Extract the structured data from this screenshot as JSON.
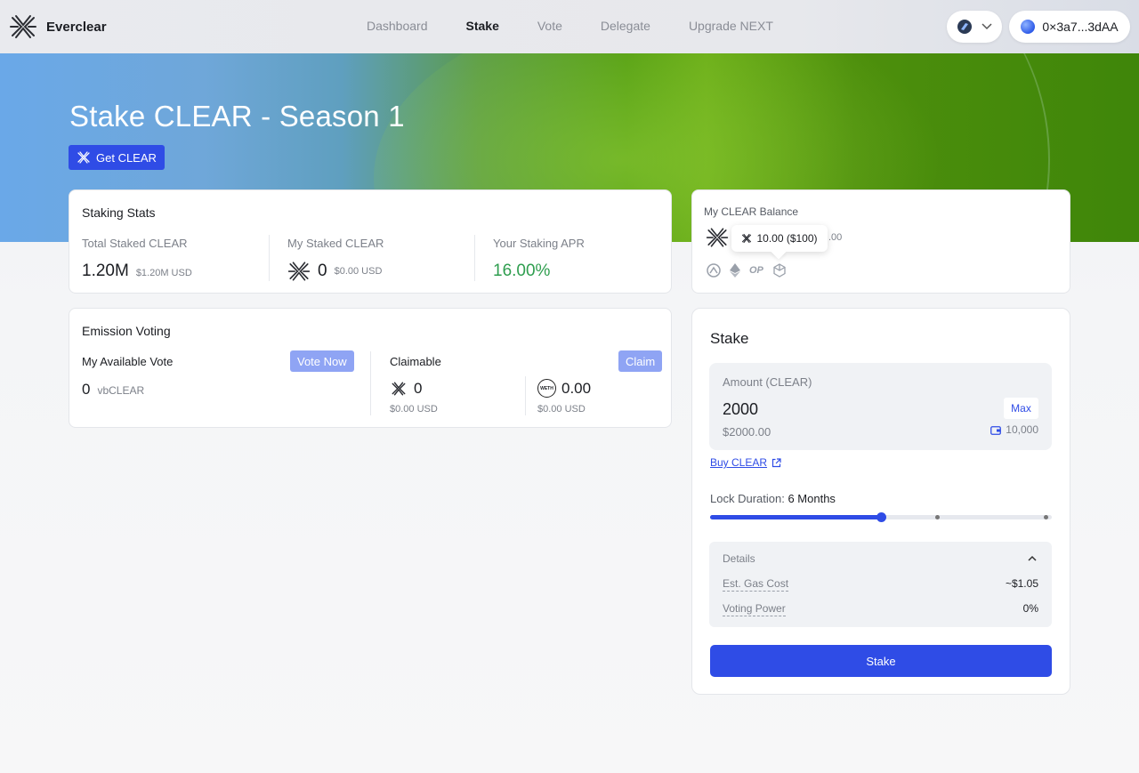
{
  "header": {
    "brand": "Everclear",
    "nav": [
      "Dashboard",
      "Stake",
      "Vote",
      "Delegate",
      "Upgrade NEXT"
    ],
    "active_nav": "Stake",
    "wallet": "0×3a7...3dAA"
  },
  "hero": {
    "title": "Stake CLEAR - Season 1",
    "get_button": "Get CLEAR"
  },
  "staking_stats": {
    "title": "Staking Stats",
    "total_label": "Total Staked CLEAR",
    "total_value": "1.20M",
    "total_usd": "$1.20M USD",
    "mine_label": "My Staked CLEAR",
    "mine_value": "0",
    "mine_usd": "$0.00 USD",
    "apr_label": "Your Staking APR",
    "apr_value": "16.00%"
  },
  "emission_voting": {
    "title": "Emission Voting",
    "available_label": "My Available Vote",
    "vote_button": "Vote Now",
    "available_value": "0",
    "available_unit": "vbCLEAR",
    "claimable_label": "Claimable",
    "claim_button": "Claim",
    "clear_value": "0",
    "clear_usd": "$0.00 USD",
    "weth_value": "0.00",
    "weth_usd": "$0.00 USD",
    "weth_badge": "WETH"
  },
  "balance": {
    "title": "My CLEAR Balance",
    "value_suffix": ".00",
    "tooltip": "10.00 ($100)",
    "chain_op": "OP"
  },
  "stake": {
    "title": "Stake",
    "amount_label": "Amount (CLEAR)",
    "amount_value": "2000",
    "amount_usd": "$2000.00",
    "max_button": "Max",
    "wallet_balance": "10,000",
    "buy_link": "Buy CLEAR",
    "lock_label": "Lock Duration:",
    "lock_value": "6 Months",
    "lock_fraction": 0.5,
    "details_label": "Details",
    "gas_label": "Est. Gas Cost",
    "gas_value": "~$1.05",
    "power_label": "Voting Power",
    "power_value": "0%",
    "stake_button": "Stake"
  },
  "colors": {
    "accent": "#2f4ce6",
    "apr_green": "#2f9e4f",
    "pill_blue": "#8fa4f4"
  }
}
